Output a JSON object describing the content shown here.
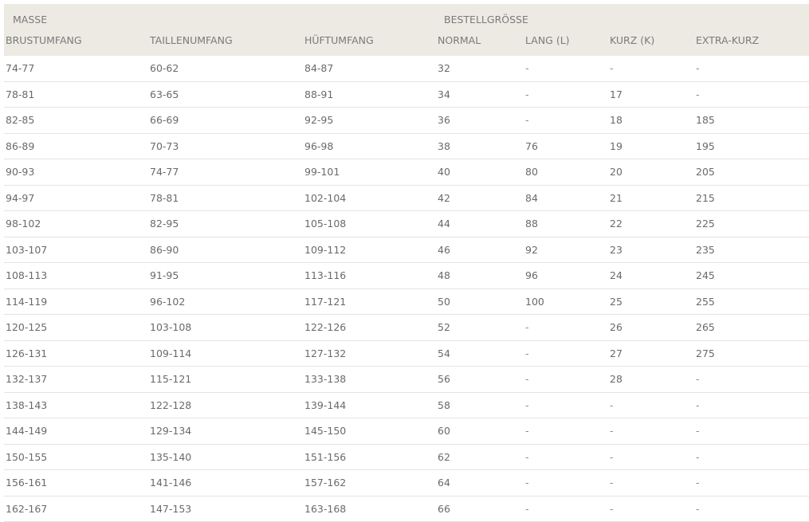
{
  "header": {
    "group_masse": "MASSE",
    "group_bestellgroesse": "BESTELLGRÖSSE",
    "columns": [
      "BRUSTUMFANG",
      "TAILLENUMFANG",
      "HÜFTUMFANG",
      "NORMAL",
      "LANG (L)",
      "KURZ (K)",
      "EXTRA-KURZ"
    ]
  },
  "rows": [
    [
      "74-77",
      "60-62",
      "84-87",
      "32",
      "-",
      "-",
      "-"
    ],
    [
      "78-81",
      "63-65",
      "88-91",
      "34",
      "-",
      "17",
      "-"
    ],
    [
      "82-85",
      "66-69",
      "92-95",
      "36",
      "-",
      "18",
      "185"
    ],
    [
      "86-89",
      "70-73",
      "96-98",
      "38",
      "76",
      "19",
      "195"
    ],
    [
      "90-93",
      "74-77",
      "99-101",
      "40",
      "80",
      "20",
      "205"
    ],
    [
      "94-97",
      "78-81",
      "102-104",
      "42",
      "84",
      "21",
      "215"
    ],
    [
      "98-102",
      "82-95",
      "105-108",
      "44",
      "88",
      "22",
      "225"
    ],
    [
      "103-107",
      "86-90",
      "109-112",
      "46",
      "92",
      "23",
      "235"
    ],
    [
      "108-113",
      "91-95",
      "113-116",
      "48",
      "96",
      "24",
      "245"
    ],
    [
      "114-119",
      "96-102",
      "117-121",
      "50",
      "100",
      "25",
      "255"
    ],
    [
      "120-125",
      "103-108",
      "122-126",
      "52",
      "-",
      "26",
      "265"
    ],
    [
      "126-131",
      "109-114",
      "127-132",
      "54",
      "-",
      "27",
      "275"
    ],
    [
      "132-137",
      "115-121",
      "133-138",
      "56",
      "-",
      "28",
      "-"
    ],
    [
      "138-143",
      "122-128",
      "139-144",
      "58",
      "-",
      "-",
      "-"
    ],
    [
      "144-149",
      "129-134",
      "145-150",
      "60",
      "-",
      "-",
      "-"
    ],
    [
      "150-155",
      "135-140",
      "151-156",
      "62",
      "-",
      "-",
      "-"
    ],
    [
      "156-161",
      "141-146",
      "157-162",
      "64",
      "-",
      "-",
      "-"
    ],
    [
      "162-167",
      "147-153",
      "163-168",
      "66",
      "-",
      "-",
      "-"
    ]
  ]
}
